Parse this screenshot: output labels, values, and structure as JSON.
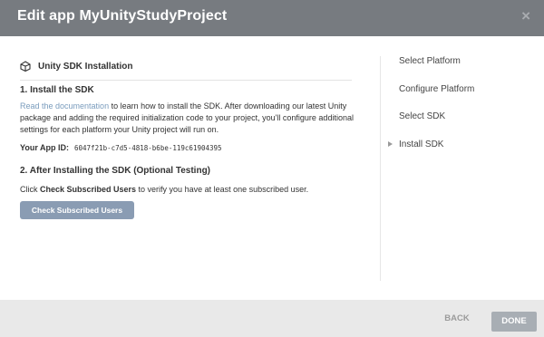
{
  "dialog": {
    "title": "Edit app MyUnityStudyProject",
    "close_label": "×"
  },
  "main": {
    "section_title": "Unity SDK Installation",
    "icon": "unity-icon",
    "step1": {
      "title": "1. Install the SDK",
      "doc_link": "Read the documentation",
      "instructions": " to learn how to install the SDK. After downloading our latest Unity package and adding the required initialization code to your project, you'll configure additional settings for each platform your Unity project will run on.",
      "app_id_label": "Your App ID:",
      "app_id_value": "6047f21b-c7d5-4818-b6be-119c61904395"
    },
    "step2": {
      "title": "2. After Installing the SDK (Optional Testing)",
      "text_prefix": "Click ",
      "text_bold": "Check Subscribed Users",
      "text_suffix": " to verify you have at least one subscribed user.",
      "button_label": "Check Subscribed Users"
    }
  },
  "sidebar": {
    "steps": [
      {
        "label": "Select Platform",
        "active": false
      },
      {
        "label": "Configure Platform",
        "active": false
      },
      {
        "label": "Select SDK",
        "active": false
      },
      {
        "label": "Install SDK",
        "active": true
      }
    ]
  },
  "footer": {
    "back_label": "BACK",
    "done_label": "DONE"
  },
  "colors": {
    "header_bg": "#777b80",
    "link": "#7a9cbd",
    "button_bg": "#8a9cb3",
    "done_bg": "#a8aeb4"
  }
}
